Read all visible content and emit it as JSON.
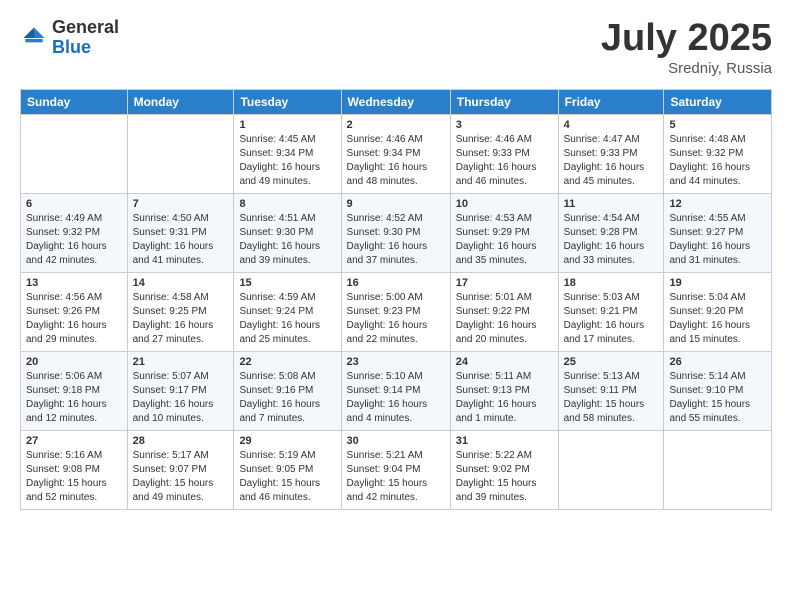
{
  "logo": {
    "general": "General",
    "blue": "Blue"
  },
  "header": {
    "title": "July 2025",
    "subtitle": "Sredniy, Russia"
  },
  "days_of_week": [
    "Sunday",
    "Monday",
    "Tuesday",
    "Wednesday",
    "Thursday",
    "Friday",
    "Saturday"
  ],
  "weeks": [
    [
      {
        "day": "",
        "sunrise": "",
        "sunset": "",
        "daylight": ""
      },
      {
        "day": "",
        "sunrise": "",
        "sunset": "",
        "daylight": ""
      },
      {
        "day": "1",
        "sunrise": "Sunrise: 4:45 AM",
        "sunset": "Sunset: 9:34 PM",
        "daylight": "Daylight: 16 hours and 49 minutes."
      },
      {
        "day": "2",
        "sunrise": "Sunrise: 4:46 AM",
        "sunset": "Sunset: 9:34 PM",
        "daylight": "Daylight: 16 hours and 48 minutes."
      },
      {
        "day": "3",
        "sunrise": "Sunrise: 4:46 AM",
        "sunset": "Sunset: 9:33 PM",
        "daylight": "Daylight: 16 hours and 46 minutes."
      },
      {
        "day": "4",
        "sunrise": "Sunrise: 4:47 AM",
        "sunset": "Sunset: 9:33 PM",
        "daylight": "Daylight: 16 hours and 45 minutes."
      },
      {
        "day": "5",
        "sunrise": "Sunrise: 4:48 AM",
        "sunset": "Sunset: 9:32 PM",
        "daylight": "Daylight: 16 hours and 44 minutes."
      }
    ],
    [
      {
        "day": "6",
        "sunrise": "Sunrise: 4:49 AM",
        "sunset": "Sunset: 9:32 PM",
        "daylight": "Daylight: 16 hours and 42 minutes."
      },
      {
        "day": "7",
        "sunrise": "Sunrise: 4:50 AM",
        "sunset": "Sunset: 9:31 PM",
        "daylight": "Daylight: 16 hours and 41 minutes."
      },
      {
        "day": "8",
        "sunrise": "Sunrise: 4:51 AM",
        "sunset": "Sunset: 9:30 PM",
        "daylight": "Daylight: 16 hours and 39 minutes."
      },
      {
        "day": "9",
        "sunrise": "Sunrise: 4:52 AM",
        "sunset": "Sunset: 9:30 PM",
        "daylight": "Daylight: 16 hours and 37 minutes."
      },
      {
        "day": "10",
        "sunrise": "Sunrise: 4:53 AM",
        "sunset": "Sunset: 9:29 PM",
        "daylight": "Daylight: 16 hours and 35 minutes."
      },
      {
        "day": "11",
        "sunrise": "Sunrise: 4:54 AM",
        "sunset": "Sunset: 9:28 PM",
        "daylight": "Daylight: 16 hours and 33 minutes."
      },
      {
        "day": "12",
        "sunrise": "Sunrise: 4:55 AM",
        "sunset": "Sunset: 9:27 PM",
        "daylight": "Daylight: 16 hours and 31 minutes."
      }
    ],
    [
      {
        "day": "13",
        "sunrise": "Sunrise: 4:56 AM",
        "sunset": "Sunset: 9:26 PM",
        "daylight": "Daylight: 16 hours and 29 minutes."
      },
      {
        "day": "14",
        "sunrise": "Sunrise: 4:58 AM",
        "sunset": "Sunset: 9:25 PM",
        "daylight": "Daylight: 16 hours and 27 minutes."
      },
      {
        "day": "15",
        "sunrise": "Sunrise: 4:59 AM",
        "sunset": "Sunset: 9:24 PM",
        "daylight": "Daylight: 16 hours and 25 minutes."
      },
      {
        "day": "16",
        "sunrise": "Sunrise: 5:00 AM",
        "sunset": "Sunset: 9:23 PM",
        "daylight": "Daylight: 16 hours and 22 minutes."
      },
      {
        "day": "17",
        "sunrise": "Sunrise: 5:01 AM",
        "sunset": "Sunset: 9:22 PM",
        "daylight": "Daylight: 16 hours and 20 minutes."
      },
      {
        "day": "18",
        "sunrise": "Sunrise: 5:03 AM",
        "sunset": "Sunset: 9:21 PM",
        "daylight": "Daylight: 16 hours and 17 minutes."
      },
      {
        "day": "19",
        "sunrise": "Sunrise: 5:04 AM",
        "sunset": "Sunset: 9:20 PM",
        "daylight": "Daylight: 16 hours and 15 minutes."
      }
    ],
    [
      {
        "day": "20",
        "sunrise": "Sunrise: 5:06 AM",
        "sunset": "Sunset: 9:18 PM",
        "daylight": "Daylight: 16 hours and 12 minutes."
      },
      {
        "day": "21",
        "sunrise": "Sunrise: 5:07 AM",
        "sunset": "Sunset: 9:17 PM",
        "daylight": "Daylight: 16 hours and 10 minutes."
      },
      {
        "day": "22",
        "sunrise": "Sunrise: 5:08 AM",
        "sunset": "Sunset: 9:16 PM",
        "daylight": "Daylight: 16 hours and 7 minutes."
      },
      {
        "day": "23",
        "sunrise": "Sunrise: 5:10 AM",
        "sunset": "Sunset: 9:14 PM",
        "daylight": "Daylight: 16 hours and 4 minutes."
      },
      {
        "day": "24",
        "sunrise": "Sunrise: 5:11 AM",
        "sunset": "Sunset: 9:13 PM",
        "daylight": "Daylight: 16 hours and 1 minute."
      },
      {
        "day": "25",
        "sunrise": "Sunrise: 5:13 AM",
        "sunset": "Sunset: 9:11 PM",
        "daylight": "Daylight: 15 hours and 58 minutes."
      },
      {
        "day": "26",
        "sunrise": "Sunrise: 5:14 AM",
        "sunset": "Sunset: 9:10 PM",
        "daylight": "Daylight: 15 hours and 55 minutes."
      }
    ],
    [
      {
        "day": "27",
        "sunrise": "Sunrise: 5:16 AM",
        "sunset": "Sunset: 9:08 PM",
        "daylight": "Daylight: 15 hours and 52 minutes."
      },
      {
        "day": "28",
        "sunrise": "Sunrise: 5:17 AM",
        "sunset": "Sunset: 9:07 PM",
        "daylight": "Daylight: 15 hours and 49 minutes."
      },
      {
        "day": "29",
        "sunrise": "Sunrise: 5:19 AM",
        "sunset": "Sunset: 9:05 PM",
        "daylight": "Daylight: 15 hours and 46 minutes."
      },
      {
        "day": "30",
        "sunrise": "Sunrise: 5:21 AM",
        "sunset": "Sunset: 9:04 PM",
        "daylight": "Daylight: 15 hours and 42 minutes."
      },
      {
        "day": "31",
        "sunrise": "Sunrise: 5:22 AM",
        "sunset": "Sunset: 9:02 PM",
        "daylight": "Daylight: 15 hours and 39 minutes."
      },
      {
        "day": "",
        "sunrise": "",
        "sunset": "",
        "daylight": ""
      },
      {
        "day": "",
        "sunrise": "",
        "sunset": "",
        "daylight": ""
      }
    ]
  ]
}
